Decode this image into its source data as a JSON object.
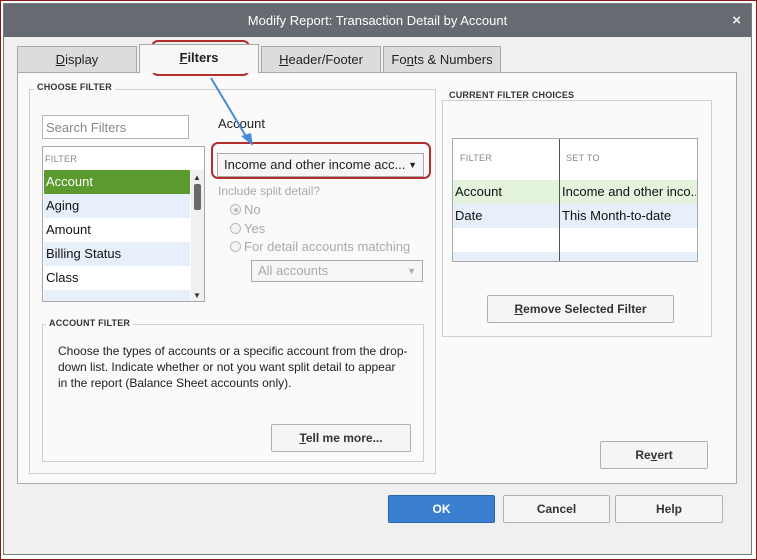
{
  "window": {
    "title": "Modify Report: Transaction Detail by Account",
    "close_glyph": "×"
  },
  "tabs": [
    {
      "key": "D",
      "rest": "isplay",
      "active": false
    },
    {
      "key": "F",
      "rest": "ilters",
      "active": true
    },
    {
      "key": "H",
      "rest": "eader/Footer",
      "active": false
    },
    {
      "pre": "Fo",
      "key": "n",
      "rest": "ts & Numbers",
      "active": false
    }
  ],
  "choose_filter": {
    "title": "CHOOSE FILTER",
    "search_placeholder": "Search Filters",
    "list_header": "FILTER",
    "items": [
      "Account",
      "Aging",
      "Amount",
      "Billing Status",
      "Class"
    ],
    "selected_index": 0
  },
  "account": {
    "label": "Account",
    "dropdown_value": "Income and other income acc...",
    "split_label": "Include split detail?",
    "radio_no": "No",
    "radio_yes": "Yes",
    "radio_matching": "For detail accounts matching",
    "matching_value": "All accounts"
  },
  "account_filter": {
    "title": "ACCOUNT FILTER",
    "description": "Choose the types of accounts or a specific account from the drop-down list. Indicate whether or not you want split detail to appear in the report (Balance Sheet accounts only).",
    "tell_more": {
      "key": "T",
      "rest": "ell me more..."
    }
  },
  "current_filters": {
    "title": "CURRENT FILTER CHOICES",
    "col_filter": "FILTER",
    "col_set_to": "SET TO",
    "rows": [
      {
        "filter": "Account",
        "set_to": "Income and other inco..."
      },
      {
        "filter": "Date",
        "set_to": "This Month-to-date"
      }
    ],
    "remove_button": {
      "key": "R",
      "rest": "emove Selected Filter"
    }
  },
  "buttons": {
    "revert": {
      "pre": "Re",
      "key": "v",
      "rest": "ert"
    },
    "ok": "OK",
    "cancel": "Cancel",
    "help": "Help"
  },
  "icons": {
    "close": "close-icon",
    "scroll_up": "scroll-up-arrow-icon",
    "scroll_down": "scroll-down-arrow-icon",
    "dropdown": "chevron-down-icon",
    "annotation_arrow": "arrow-icon"
  },
  "colors": {
    "titlebar": "#666b71",
    "selected_row": "#5a9a2e",
    "alt_row": "#e7f0fa",
    "ok_button": "#3a7fd0",
    "highlight": "#b32d2d",
    "arrow": "#4a8ad8"
  }
}
